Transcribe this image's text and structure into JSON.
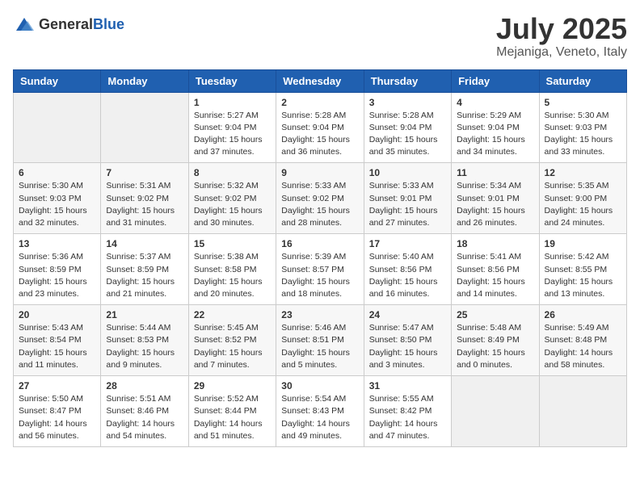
{
  "logo": {
    "text_general": "General",
    "text_blue": "Blue"
  },
  "header": {
    "month": "July 2025",
    "location": "Mejaniga, Veneto, Italy"
  },
  "weekdays": [
    "Sunday",
    "Monday",
    "Tuesday",
    "Wednesday",
    "Thursday",
    "Friday",
    "Saturday"
  ],
  "weeks": [
    [
      {
        "day": "",
        "sunrise": "",
        "sunset": "",
        "daylight": ""
      },
      {
        "day": "",
        "sunrise": "",
        "sunset": "",
        "daylight": ""
      },
      {
        "day": "1",
        "sunrise": "Sunrise: 5:27 AM",
        "sunset": "Sunset: 9:04 PM",
        "daylight": "Daylight: 15 hours and 37 minutes."
      },
      {
        "day": "2",
        "sunrise": "Sunrise: 5:28 AM",
        "sunset": "Sunset: 9:04 PM",
        "daylight": "Daylight: 15 hours and 36 minutes."
      },
      {
        "day": "3",
        "sunrise": "Sunrise: 5:28 AM",
        "sunset": "Sunset: 9:04 PM",
        "daylight": "Daylight: 15 hours and 35 minutes."
      },
      {
        "day": "4",
        "sunrise": "Sunrise: 5:29 AM",
        "sunset": "Sunset: 9:04 PM",
        "daylight": "Daylight: 15 hours and 34 minutes."
      },
      {
        "day": "5",
        "sunrise": "Sunrise: 5:30 AM",
        "sunset": "Sunset: 9:03 PM",
        "daylight": "Daylight: 15 hours and 33 minutes."
      }
    ],
    [
      {
        "day": "6",
        "sunrise": "Sunrise: 5:30 AM",
        "sunset": "Sunset: 9:03 PM",
        "daylight": "Daylight: 15 hours and 32 minutes."
      },
      {
        "day": "7",
        "sunrise": "Sunrise: 5:31 AM",
        "sunset": "Sunset: 9:02 PM",
        "daylight": "Daylight: 15 hours and 31 minutes."
      },
      {
        "day": "8",
        "sunrise": "Sunrise: 5:32 AM",
        "sunset": "Sunset: 9:02 PM",
        "daylight": "Daylight: 15 hours and 30 minutes."
      },
      {
        "day": "9",
        "sunrise": "Sunrise: 5:33 AM",
        "sunset": "Sunset: 9:02 PM",
        "daylight": "Daylight: 15 hours and 28 minutes."
      },
      {
        "day": "10",
        "sunrise": "Sunrise: 5:33 AM",
        "sunset": "Sunset: 9:01 PM",
        "daylight": "Daylight: 15 hours and 27 minutes."
      },
      {
        "day": "11",
        "sunrise": "Sunrise: 5:34 AM",
        "sunset": "Sunset: 9:01 PM",
        "daylight": "Daylight: 15 hours and 26 minutes."
      },
      {
        "day": "12",
        "sunrise": "Sunrise: 5:35 AM",
        "sunset": "Sunset: 9:00 PM",
        "daylight": "Daylight: 15 hours and 24 minutes."
      }
    ],
    [
      {
        "day": "13",
        "sunrise": "Sunrise: 5:36 AM",
        "sunset": "Sunset: 8:59 PM",
        "daylight": "Daylight: 15 hours and 23 minutes."
      },
      {
        "day": "14",
        "sunrise": "Sunrise: 5:37 AM",
        "sunset": "Sunset: 8:59 PM",
        "daylight": "Daylight: 15 hours and 21 minutes."
      },
      {
        "day": "15",
        "sunrise": "Sunrise: 5:38 AM",
        "sunset": "Sunset: 8:58 PM",
        "daylight": "Daylight: 15 hours and 20 minutes."
      },
      {
        "day": "16",
        "sunrise": "Sunrise: 5:39 AM",
        "sunset": "Sunset: 8:57 PM",
        "daylight": "Daylight: 15 hours and 18 minutes."
      },
      {
        "day": "17",
        "sunrise": "Sunrise: 5:40 AM",
        "sunset": "Sunset: 8:56 PM",
        "daylight": "Daylight: 15 hours and 16 minutes."
      },
      {
        "day": "18",
        "sunrise": "Sunrise: 5:41 AM",
        "sunset": "Sunset: 8:56 PM",
        "daylight": "Daylight: 15 hours and 14 minutes."
      },
      {
        "day": "19",
        "sunrise": "Sunrise: 5:42 AM",
        "sunset": "Sunset: 8:55 PM",
        "daylight": "Daylight: 15 hours and 13 minutes."
      }
    ],
    [
      {
        "day": "20",
        "sunrise": "Sunrise: 5:43 AM",
        "sunset": "Sunset: 8:54 PM",
        "daylight": "Daylight: 15 hours and 11 minutes."
      },
      {
        "day": "21",
        "sunrise": "Sunrise: 5:44 AM",
        "sunset": "Sunset: 8:53 PM",
        "daylight": "Daylight: 15 hours and 9 minutes."
      },
      {
        "day": "22",
        "sunrise": "Sunrise: 5:45 AM",
        "sunset": "Sunset: 8:52 PM",
        "daylight": "Daylight: 15 hours and 7 minutes."
      },
      {
        "day": "23",
        "sunrise": "Sunrise: 5:46 AM",
        "sunset": "Sunset: 8:51 PM",
        "daylight": "Daylight: 15 hours and 5 minutes."
      },
      {
        "day": "24",
        "sunrise": "Sunrise: 5:47 AM",
        "sunset": "Sunset: 8:50 PM",
        "daylight": "Daylight: 15 hours and 3 minutes."
      },
      {
        "day": "25",
        "sunrise": "Sunrise: 5:48 AM",
        "sunset": "Sunset: 8:49 PM",
        "daylight": "Daylight: 15 hours and 0 minutes."
      },
      {
        "day": "26",
        "sunrise": "Sunrise: 5:49 AM",
        "sunset": "Sunset: 8:48 PM",
        "daylight": "Daylight: 14 hours and 58 minutes."
      }
    ],
    [
      {
        "day": "27",
        "sunrise": "Sunrise: 5:50 AM",
        "sunset": "Sunset: 8:47 PM",
        "daylight": "Daylight: 14 hours and 56 minutes."
      },
      {
        "day": "28",
        "sunrise": "Sunrise: 5:51 AM",
        "sunset": "Sunset: 8:46 PM",
        "daylight": "Daylight: 14 hours and 54 minutes."
      },
      {
        "day": "29",
        "sunrise": "Sunrise: 5:52 AM",
        "sunset": "Sunset: 8:44 PM",
        "daylight": "Daylight: 14 hours and 51 minutes."
      },
      {
        "day": "30",
        "sunrise": "Sunrise: 5:54 AM",
        "sunset": "Sunset: 8:43 PM",
        "daylight": "Daylight: 14 hours and 49 minutes."
      },
      {
        "day": "31",
        "sunrise": "Sunrise: 5:55 AM",
        "sunset": "Sunset: 8:42 PM",
        "daylight": "Daylight: 14 hours and 47 minutes."
      },
      {
        "day": "",
        "sunrise": "",
        "sunset": "",
        "daylight": ""
      },
      {
        "day": "",
        "sunrise": "",
        "sunset": "",
        "daylight": ""
      }
    ]
  ]
}
